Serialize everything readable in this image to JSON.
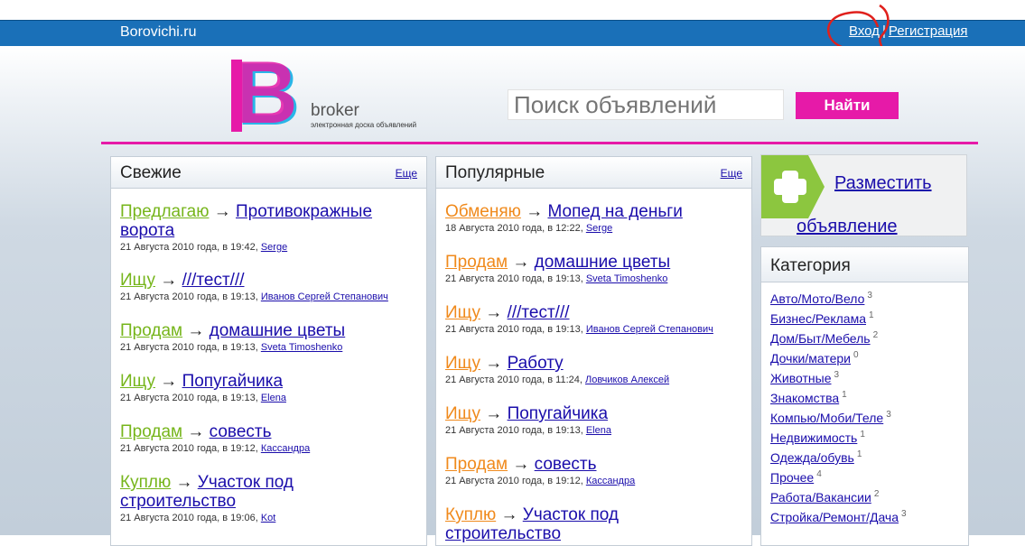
{
  "topbar": {
    "site_name": "Borovichi.ru",
    "login": "Вход",
    "separator": "|",
    "register": "Регистрация"
  },
  "logo": {
    "wordmark": "broker",
    "tagline": "электронная доска объявлений"
  },
  "search": {
    "placeholder": "Поиск объявлений",
    "button": "Найти"
  },
  "fresh": {
    "title": "Свежие",
    "more": "Еще",
    "items": [
      {
        "action": "Предлагаю",
        "arrow": "→",
        "title_a": "Противокражные",
        "title_b": "ворота",
        "date": "21 Августа 2010 года, в 19:42,",
        "user": "Serge"
      },
      {
        "action": "Ищу",
        "arrow": "→",
        "title_a": "///тест///",
        "date": "21 Августа 2010 года, в 19:13,",
        "user": "Иванов Сергей Степанович"
      },
      {
        "action": "Продам",
        "arrow": "→",
        "title_a": "домашние цветы",
        "date": "21 Августа 2010 года, в 19:13,",
        "user": "Sveta Timoshenko"
      },
      {
        "action": "Ищу",
        "arrow": "→",
        "title_a": "Попугайчика",
        "date": "21 Августа 2010 года, в 19:13,",
        "user": "Elena"
      },
      {
        "action": "Продам",
        "arrow": "→",
        "title_a": "совесть",
        "date": "21 Августа 2010 года, в 19:12,",
        "user": "Кассандра"
      },
      {
        "action": "Куплю",
        "arrow": "→",
        "title_a": "Участок под",
        "title_b": "строительство",
        "date": "21 Августа 2010 года, в 19:06,",
        "user": "Kot"
      }
    ]
  },
  "popular": {
    "title": "Популярные",
    "more": "Еще",
    "items": [
      {
        "action": "Обменяю",
        "arrow": "→",
        "title_a": "Мопед на деньги",
        "date": "18 Августа 2010 года, в 12:22,",
        "user": "Serge"
      },
      {
        "action": "Продам",
        "arrow": "→",
        "title_a": "домашние цветы",
        "date": "21 Августа 2010 года, в 19:13,",
        "user": "Sveta Timoshenko"
      },
      {
        "action": "Ищу",
        "arrow": "→",
        "title_a": "///тест///",
        "date": "21 Августа 2010 года, в 19:13,",
        "user": "Иванов Сергей Степанович"
      },
      {
        "action": "Ищу",
        "arrow": "→",
        "title_a": "Работу",
        "date": "21 Августа 2010 года, в 11:24,",
        "user": "Ловчиков Алексей"
      },
      {
        "action": "Ищу",
        "arrow": "→",
        "title_a": "Попугайчика",
        "date": "21 Августа 2010 года, в 19:13,",
        "user": "Elena"
      },
      {
        "action": "Продам",
        "arrow": "→",
        "title_a": "совесть",
        "date": "21 Августа 2010 года, в 19:12,",
        "user": "Кассандра"
      },
      {
        "action": "Куплю",
        "arrow": "→",
        "title_a": "Участок под",
        "title_b": "строительство"
      }
    ]
  },
  "post": {
    "line1": "Разместить",
    "line2": "объявление"
  },
  "categories": {
    "title": "Категория",
    "items": [
      {
        "name": "Авто/Мото/Вело",
        "count": "3"
      },
      {
        "name": "Бизнес/Реклама",
        "count": "1"
      },
      {
        "name": "Дом/Быт/Мебель",
        "count": "2"
      },
      {
        "name": "Дочки/матери",
        "count": "0"
      },
      {
        "name": "Животные",
        "count": "3"
      },
      {
        "name": "Знакомства",
        "count": "1"
      },
      {
        "name": "Компью/Моби/Теле",
        "count": "3"
      },
      {
        "name": "Недвижимость",
        "count": "1"
      },
      {
        "name": "Одежда/обувь",
        "count": "1"
      },
      {
        "name": "Прочее",
        "count": "4"
      },
      {
        "name": "Работа/Вакансии",
        "count": "2"
      },
      {
        "name": "Стройка/Ремонт/Дача",
        "count": "3"
      }
    ]
  },
  "colors": {
    "topbar": "#1a70b8",
    "accent_pink": "#e61aa8",
    "action_green": "#76b51b",
    "action_orange": "#f08a1c",
    "link": "#1a0dab"
  }
}
